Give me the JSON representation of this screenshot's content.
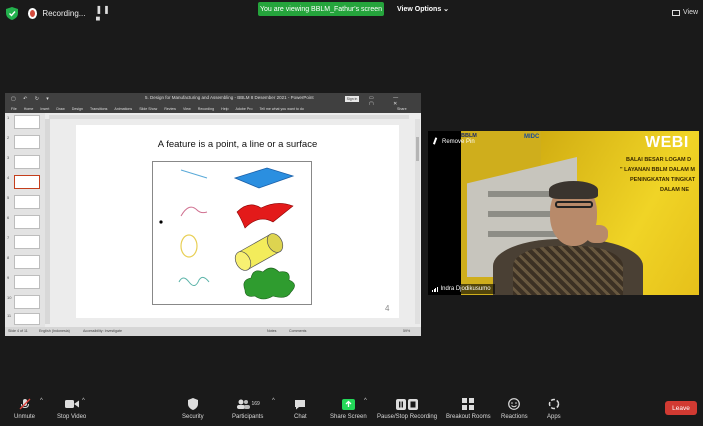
{
  "top": {
    "recording_label": "Recording...",
    "recording_controls": "❚❚ ■",
    "viewing_banner": "You are viewing BBLM_Fathur's screen",
    "view_options": "View Options ⌄",
    "view_button": "View"
  },
  "ppt": {
    "doc_title": "5. Design for Manufacturing and Assembling - BBLM 8 Desember 2021 - PowerPoint",
    "sign_in": "Sign in",
    "qat": "▢ ↶ ↻ ▾",
    "window_controls": "▭ — ▢ ✕",
    "menu": [
      "File",
      "Home",
      "Insert",
      "Draw",
      "Design",
      "Transitions",
      "Animations",
      "Slide Show",
      "Review",
      "View",
      "Recording",
      "Help",
      "Adobe Pro",
      "Tell me what you want to do"
    ],
    "share": "Share",
    "slide_title": "A feature is a point, a line or a surface",
    "slide_number": "4",
    "thumb_numbers": [
      "1",
      "2",
      "3",
      "4",
      "5",
      "6",
      "7",
      "8",
      "9",
      "10",
      "11"
    ],
    "status_slide": "Slide 4 of 11",
    "status_lang": "English (Indonesia)",
    "status_access": "Accessibility: Investigate",
    "status_notes": "Notes",
    "status_comments": "Comments",
    "status_zoom": "59%"
  },
  "video": {
    "remove_pin": "Remove Pin",
    "participant_name": "Indra Djodikusumo",
    "banner_title": "WEBI",
    "banner_logos": "BBLM",
    "banner_midc": "MIDC",
    "banner_line1": "BALAI BESAR LOGAM D",
    "banner_line2": "\" LAYANAN BBLM DALAM M",
    "banner_line3": "PENINGKATAN TINGKAT",
    "banner_line4": "DALAM NE"
  },
  "toolbar": {
    "unmute": "Unmute",
    "stop_video": "Stop Video",
    "security": "Security",
    "participants": "Participants",
    "participants_count": "169",
    "chat": "Chat",
    "share_screen": "Share Screen",
    "pause_recording": "Pause/Stop Recording",
    "breakout": "Breakout Rooms",
    "reactions": "Reactions",
    "apps": "Apps",
    "leave": "Leave",
    "caret": "^"
  },
  "colors": {
    "viewing_green": "#25a43c",
    "share_green": "#23d959",
    "leave_red": "#d13a32",
    "banner_yellow": "#f0d426"
  }
}
